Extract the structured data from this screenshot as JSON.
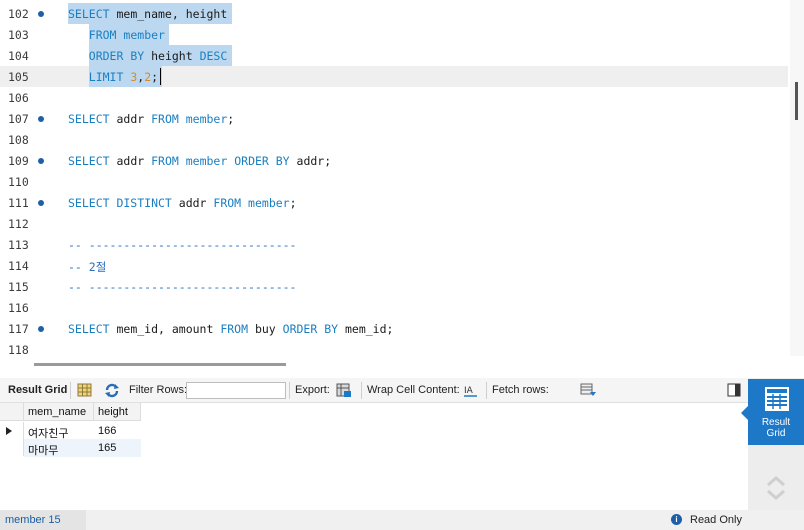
{
  "editor": {
    "lines": [
      {
        "n": "102",
        "dot": true,
        "selected": true,
        "current": false,
        "tokens": [
          {
            "t": "kw",
            "v": "SELECT"
          },
          {
            "t": "",
            "v": " mem_name, height"
          }
        ]
      },
      {
        "n": "103",
        "dot": false,
        "selected": true,
        "current": false,
        "tokens": [
          {
            "t": "",
            "v": "   "
          },
          {
            "t": "kw",
            "v": "FROM"
          },
          {
            "t": "",
            "v": " "
          },
          {
            "t": "kw",
            "v": "member"
          }
        ]
      },
      {
        "n": "104",
        "dot": false,
        "selected": true,
        "current": false,
        "tokens": [
          {
            "t": "",
            "v": "   "
          },
          {
            "t": "kw",
            "v": "ORDER BY"
          },
          {
            "t": "",
            "v": " height "
          },
          {
            "t": "kw",
            "v": "DESC"
          }
        ]
      },
      {
        "n": "105",
        "dot": false,
        "selected": true,
        "current": true,
        "tokens": [
          {
            "t": "",
            "v": "   "
          },
          {
            "t": "kw",
            "v": "LIMIT"
          },
          {
            "t": "",
            "v": " "
          },
          {
            "t": "num",
            "v": "3"
          },
          {
            "t": "",
            "v": ","
          },
          {
            "t": "num",
            "v": "2"
          },
          {
            "t": "",
            "v": ";"
          }
        ]
      },
      {
        "n": "106",
        "dot": false,
        "selected": false,
        "current": false,
        "tokens": []
      },
      {
        "n": "107",
        "dot": true,
        "selected": false,
        "current": false,
        "tokens": [
          {
            "t": "kw",
            "v": "SELECT"
          },
          {
            "t": "",
            "v": " addr "
          },
          {
            "t": "kw",
            "v": "FROM"
          },
          {
            "t": "",
            "v": " "
          },
          {
            "t": "kw",
            "v": "member"
          },
          {
            "t": "",
            "v": ";"
          }
        ]
      },
      {
        "n": "108",
        "dot": false,
        "selected": false,
        "current": false,
        "tokens": []
      },
      {
        "n": "109",
        "dot": true,
        "selected": false,
        "current": false,
        "tokens": [
          {
            "t": "kw",
            "v": "SELECT"
          },
          {
            "t": "",
            "v": " addr "
          },
          {
            "t": "kw",
            "v": "FROM"
          },
          {
            "t": "",
            "v": " "
          },
          {
            "t": "kw",
            "v": "member"
          },
          {
            "t": "",
            "v": " "
          },
          {
            "t": "kw",
            "v": "ORDER BY"
          },
          {
            "t": "",
            "v": " addr;"
          }
        ]
      },
      {
        "n": "110",
        "dot": false,
        "selected": false,
        "current": false,
        "tokens": []
      },
      {
        "n": "111",
        "dot": true,
        "selected": false,
        "current": false,
        "tokens": [
          {
            "t": "kw",
            "v": "SELECT DISTINCT"
          },
          {
            "t": "",
            "v": " addr "
          },
          {
            "t": "kw",
            "v": "FROM"
          },
          {
            "t": "",
            "v": " "
          },
          {
            "t": "kw",
            "v": "member"
          },
          {
            "t": "",
            "v": ";"
          }
        ]
      },
      {
        "n": "112",
        "dot": false,
        "selected": false,
        "current": false,
        "tokens": []
      },
      {
        "n": "113",
        "dot": false,
        "selected": false,
        "current": false,
        "tokens": [
          {
            "t": "cm",
            "v": "-- ------------------------------"
          }
        ]
      },
      {
        "n": "114",
        "dot": false,
        "selected": false,
        "current": false,
        "tokens": [
          {
            "t": "cm",
            "v": "-- 2절"
          }
        ]
      },
      {
        "n": "115",
        "dot": false,
        "selected": false,
        "current": false,
        "tokens": [
          {
            "t": "cm",
            "v": "-- ------------------------------"
          }
        ]
      },
      {
        "n": "116",
        "dot": false,
        "selected": false,
        "current": false,
        "tokens": []
      },
      {
        "n": "117",
        "dot": true,
        "selected": false,
        "current": false,
        "tokens": [
          {
            "t": "kw",
            "v": "SELECT"
          },
          {
            "t": "",
            "v": " mem_id, amount "
          },
          {
            "t": "kw",
            "v": "FROM"
          },
          {
            "t": "",
            "v": " buy "
          },
          {
            "t": "kw",
            "v": "ORDER BY"
          },
          {
            "t": "",
            "v": " mem_id;"
          }
        ]
      },
      {
        "n": "118",
        "dot": false,
        "selected": false,
        "current": false,
        "tokens": []
      }
    ]
  },
  "toolbar": {
    "result_grid": "Result Grid",
    "filter_rows": "Filter Rows:",
    "filter_value": "",
    "export": "Export:",
    "wrap_cell": "Wrap Cell Content:",
    "fetch_rows": "Fetch rows:"
  },
  "grid": {
    "columns": [
      "mem_name",
      "height"
    ],
    "rows": [
      [
        "여자친구",
        "166"
      ],
      [
        "마마무",
        "165"
      ]
    ]
  },
  "side": {
    "result_grid_line1": "Result",
    "result_grid_line2": "Grid"
  },
  "status": {
    "tab": "member 15",
    "read_only": "Read Only"
  },
  "colors": {
    "accent": "#1e78c8",
    "keyword": "#1a7fc1",
    "selection": "#bcd8f0"
  }
}
